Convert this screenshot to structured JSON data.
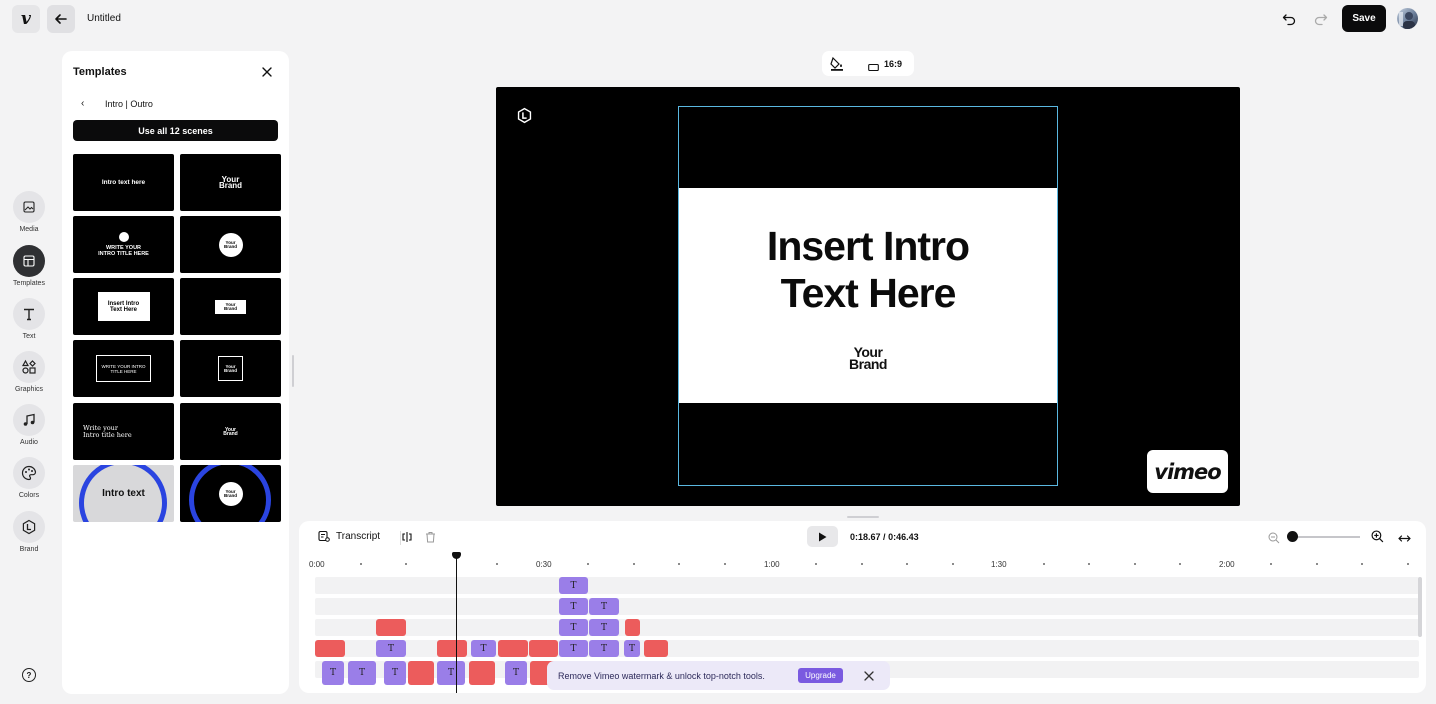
{
  "header": {
    "logo_glyph": "v",
    "title": "Untitled",
    "save_label": "Save"
  },
  "rail": [
    {
      "label": "Media",
      "icon": "image-icon"
    },
    {
      "label": "Templates",
      "icon": "templates-icon",
      "active": true
    },
    {
      "label": "Text",
      "icon": "text-icon"
    },
    {
      "label": "Graphics",
      "icon": "shapes-icon"
    },
    {
      "label": "Audio",
      "icon": "music-icon"
    },
    {
      "label": "Colors",
      "icon": "palette-icon"
    },
    {
      "label": "Brand",
      "icon": "brand-icon"
    }
  ],
  "help_glyph": "?",
  "panel": {
    "title": "Templates",
    "back_glyph": "‹",
    "breadcrumb": "Intro | Outro",
    "use_all_label": "Use all 12 scenes",
    "thumbs": [
      {
        "text": "Intro text here"
      },
      {
        "text": "Your\nBrand"
      },
      {
        "text": "WRITE YOUR\nINTRO TITLE HERE"
      },
      {
        "text": "Your\nBrand"
      },
      {
        "text": "Insert Intro\nText Here"
      },
      {
        "text": "Your\nBrand"
      },
      {
        "text": "WRITE YOUR INTRO\nTITLE HERE"
      },
      {
        "text": "Your\nBrand"
      },
      {
        "text": "Write your\nIntro title here"
      },
      {
        "text": "Your\nBrand"
      },
      {
        "text": "Intro text"
      },
      {
        "text": "Your\nBrand"
      }
    ]
  },
  "preview": {
    "ratio_label": "16:9",
    "intro_line1": "Insert Intro",
    "intro_line2": "Text Here",
    "brand_line1": "Your",
    "brand_line2": "Brand",
    "watermark": "vimeo"
  },
  "timeline": {
    "transcript_label": "Transcript",
    "time_current": "0:18.67",
    "time_sep": "/",
    "time_total": "0:46.43",
    "tick_labels": [
      "0:00",
      "0:30",
      "1:00",
      "1:30",
      "2:00"
    ],
    "clip_glyph": "T"
  },
  "toast": {
    "message": "Remove Vimeo watermark & unlock top-notch tools.",
    "upgrade_label": "Upgrade"
  },
  "colors": {
    "accent_purple": "#9a7ee8",
    "clip_red": "#ec5c5c",
    "selection_blue": "#5ab7e0",
    "upgrade_purple": "#7a5ae0"
  }
}
